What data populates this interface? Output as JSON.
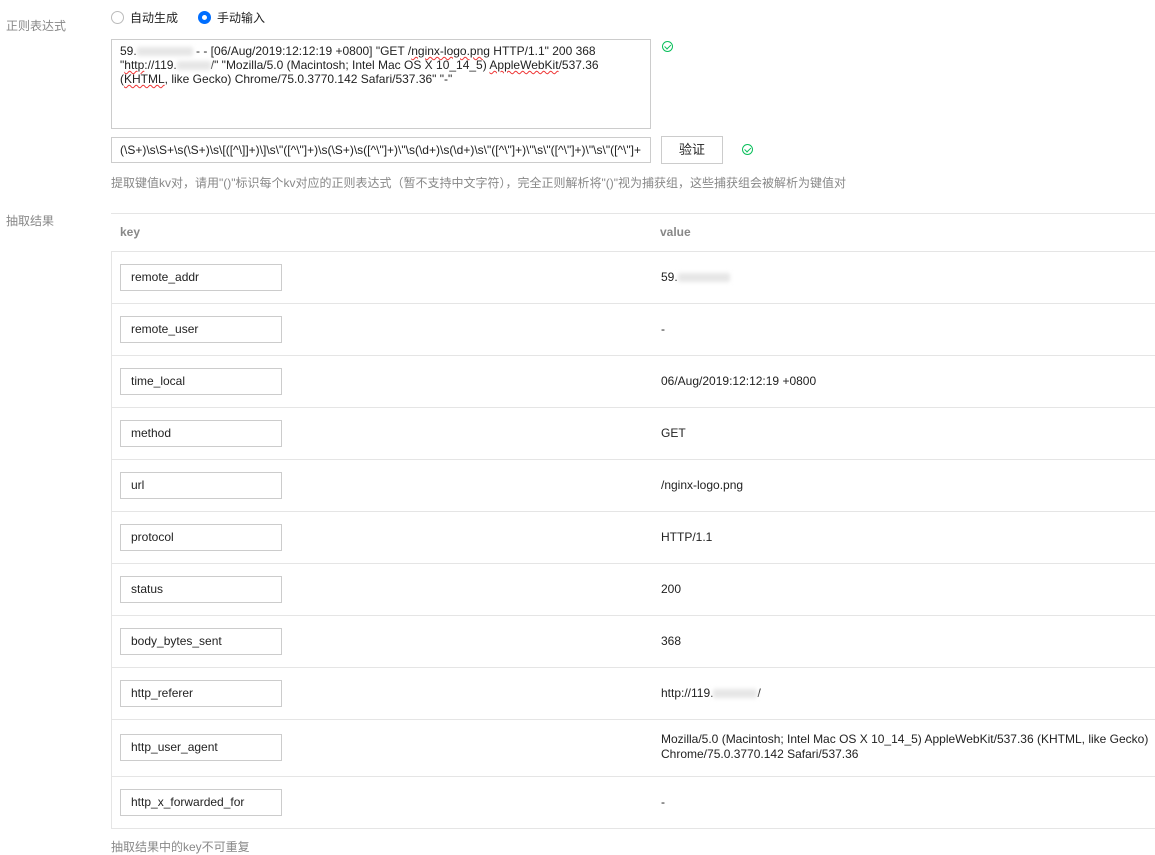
{
  "form": {
    "regex_label": "正则表达式",
    "mode_auto": "自动生成",
    "mode_manual": "手动输入",
    "selected_mode": "manual",
    "sample_log_line1_prefix": "59.",
    "sample_log_line1_rest": " - - [06/Aug/2019:12:12:19 +0800] \"GET /",
    "sample_log_line1_url": "nginx-logo.png",
    "sample_log_line1_tail": " HTTP/1.1\" 200 368",
    "sample_log_line2_prefix": "\"",
    "sample_log_line2_http": "http",
    "sample_log_line2_host": "://119.",
    "sample_log_line2_tail": "/\" \"Mozilla/5.0 (Macintosh; Intel Mac OS X 10_14_5) ",
    "sample_log_line2_applewebkit": "AppleWebKit",
    "sample_log_line2_end": "/537.36",
    "sample_log_line3_khtml": "KHTML",
    "sample_log_line3_rest": ", like Gecko) Chrome/75.0.3770.142 Safari/537.36\" \"-\"",
    "regex_value": "(\\S+)\\s\\S+\\s(\\S+)\\s\\[([^\\]]+)\\]\\s\\\"([^\\\"]+)\\s(\\S+)\\s([^\\\"]+)\\\"\\s(\\d+)\\s(\\d+)\\s\\\"([^\\\"]+)\\\"\\s\\\"([^\\\"]+)\\\"\\s\\\"([^\\\"]+",
    "validate_button": "验证",
    "hint": "提取键值kv对，请用\"()\"标识每个kv对应的正则表达式（暂不支持中文字符），完全正则解析将\"()\"视为捕获组，这些捕获组会被解析为键值对"
  },
  "result": {
    "label": "抽取结果",
    "col_key": "key",
    "col_value": "value",
    "rows": [
      {
        "key": "remote_addr",
        "value": "59."
      },
      {
        "key": "remote_user",
        "value": "-"
      },
      {
        "key": "time_local",
        "value": "06/Aug/2019:12:12:19 +0800"
      },
      {
        "key": "method",
        "value": "GET"
      },
      {
        "key": "url",
        "value": "/nginx-logo.png"
      },
      {
        "key": "protocol",
        "value": "HTTP/1.1"
      },
      {
        "key": "status",
        "value": "200"
      },
      {
        "key": "body_bytes_sent",
        "value": "368"
      },
      {
        "key": "http_referer",
        "value": "http://119.",
        "value_suffix": "/"
      },
      {
        "key": "http_user_agent",
        "value": "Mozilla/5.0 (Macintosh; Intel Mac OS X 10_14_5) AppleWebKit/537.36 (KHTML, like Gecko)",
        "value_line2": "Chrome/75.0.3770.142 Safari/537.36"
      },
      {
        "key": "http_x_forwarded_for",
        "value": "-"
      }
    ],
    "footer": "抽取结果中的key不可重复"
  },
  "colors": {
    "accent": "#006eff",
    "success": "#0abf5b"
  }
}
